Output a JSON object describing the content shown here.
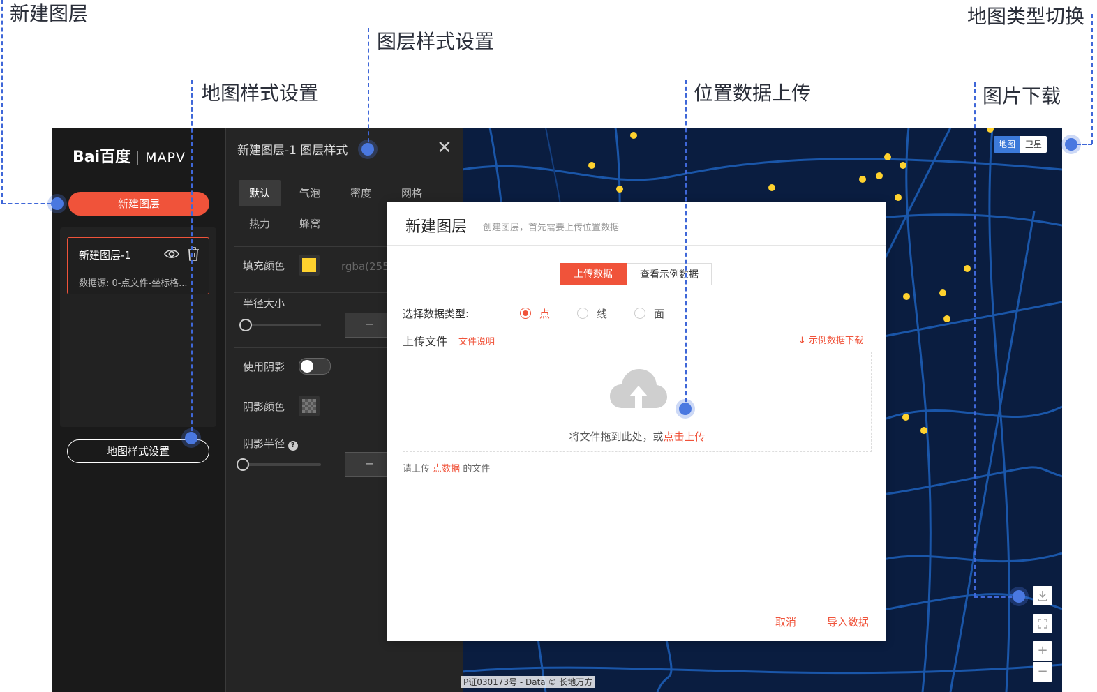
{
  "annotations": {
    "new_layer": "新建图层",
    "map_style": "地图样式设置",
    "layer_style": "图层样式设置",
    "location_upload": "位置数据上传",
    "map_type_switch": "地图类型切换",
    "image_download": "图片下载"
  },
  "sidebar": {
    "logo": "Bai百度",
    "product": "MAPV",
    "new_layer_button": "新建图层",
    "layer": {
      "name": "新建图层-1",
      "source": "数据源: 0-点文件-坐标格..."
    },
    "map_style_button": "地图样式设置"
  },
  "style_panel": {
    "title": "新建图层-1 图层样式",
    "close": "✕",
    "tabs": [
      "默认",
      "气泡",
      "密度",
      "网格",
      "热力",
      "蜂窝"
    ],
    "fill_color_label": "填充颜色",
    "fill_color_value": "rgba(255",
    "fill_color": "#ffd22e",
    "radius_label": "半径大小",
    "shadow_label": "使用阴影",
    "shadow_color_label": "阴影颜色",
    "shadow_radius_label": "阴影半径",
    "stepper_minus": "−"
  },
  "dialog": {
    "title": "新建图层",
    "subtitle": "创建图层，首先需要上传位置数据",
    "tab_upload": "上传数据",
    "tab_example": "查看示例数据",
    "data_type_label": "选择数据类型:",
    "data_types": [
      "点",
      "线",
      "面"
    ],
    "selected_type": "点",
    "upload_label": "上传文件",
    "file_help": "文件说明",
    "sample_download": "示例数据下载",
    "drop_text": "将文件拖到此处，或",
    "drop_link": "点击上传",
    "hint_prefix": "请上传",
    "hint_highlight": "点数据",
    "hint_suffix": "的文件",
    "cancel": "取消",
    "import": "导入数据"
  },
  "map": {
    "toggle_map": "地图",
    "toggle_satellite": "卫星",
    "zoom_in": "+",
    "zoom_out": "−",
    "copyright": "P证030173号 - Data © 长地万方",
    "point_color": "#ffd22e",
    "road_color": "#1f6fd0"
  },
  "colors": {
    "accent": "#f0533a",
    "annotation": "#3f67d8"
  }
}
